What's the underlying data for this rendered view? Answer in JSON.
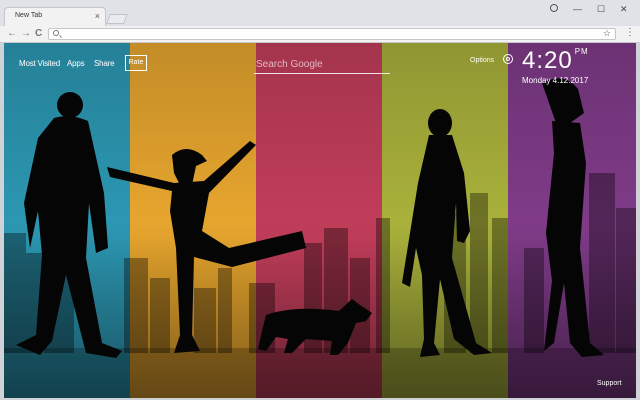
{
  "browser": {
    "tab_title": "New Tab",
    "tab_close": "×",
    "minimize": "—",
    "maximize": "☐",
    "close": "✕",
    "back": "←",
    "forward": "→",
    "reload": "C",
    "bookmark": "☆",
    "menu": "⋮",
    "url": ""
  },
  "nav": {
    "most_visited": "Most Visited",
    "apps": "Apps",
    "share": "Share",
    "rate": "Rate"
  },
  "search": {
    "placeholder": "Search Google"
  },
  "options": {
    "label": "Options"
  },
  "clock": {
    "time": "4:20",
    "ampm": "PM",
    "date": "Monday  4.12.2017"
  },
  "footer": {
    "support": "Support"
  },
  "wallpaper": {
    "stripe_colors": [
      "#2c97b2",
      "#e6a52e",
      "#c13d5a",
      "#a9b13b",
      "#7f3b88"
    ]
  }
}
